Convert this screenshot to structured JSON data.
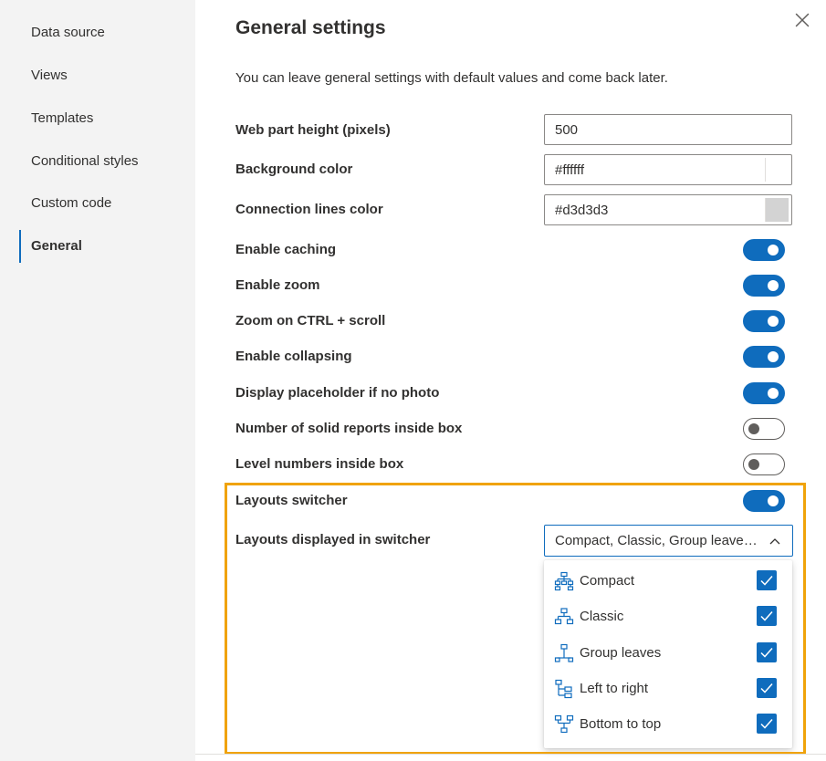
{
  "sidebar": {
    "items": [
      {
        "label": "Data source"
      },
      {
        "label": "Views"
      },
      {
        "label": "Templates"
      },
      {
        "label": "Conditional styles"
      },
      {
        "label": "Custom code"
      },
      {
        "label": "General"
      }
    ],
    "active": "General"
  },
  "panel": {
    "title": "General settings",
    "description": "You can leave general settings with default values and come back later."
  },
  "settings": {
    "web_part_height": {
      "label": "Web part height (pixels)",
      "value": "500"
    },
    "background_color": {
      "label": "Background color",
      "value": "#ffffff",
      "swatch": "#ffffff"
    },
    "connection_lines_color": {
      "label": "Connection lines color",
      "value": "#d3d3d3",
      "swatch": "#d3d3d3"
    },
    "toggles": [
      {
        "label": "Enable caching",
        "on": true
      },
      {
        "label": "Enable zoom",
        "on": true
      },
      {
        "label": "Zoom on CTRL + scroll",
        "on": true
      },
      {
        "label": "Enable collapsing",
        "on": true
      },
      {
        "label": "Display placeholder if no photo",
        "on": true
      },
      {
        "label": "Number of solid reports inside box",
        "on": false
      },
      {
        "label": "Level numbers inside box",
        "on": false
      },
      {
        "label": "Layouts switcher",
        "on": true
      }
    ],
    "layouts_displayed": {
      "label": "Layouts displayed in switcher",
      "value": "Compact, Classic, Group leaves, Left to right, Bottom to top",
      "options": [
        {
          "label": "Compact",
          "icon": "compact-layout-icon",
          "checked": true
        },
        {
          "label": "Classic",
          "icon": "classic-layout-icon",
          "checked": true
        },
        {
          "label": "Group leaves",
          "icon": "group-leaves-layout-icon",
          "checked": true
        },
        {
          "label": "Left to right",
          "icon": "left-to-right-layout-icon",
          "checked": true
        },
        {
          "label": "Bottom to top",
          "icon": "bottom-to-top-layout-icon",
          "checked": true
        }
      ]
    }
  },
  "colors": {
    "accent": "#0f6cbd",
    "highlight": "#f0a30a",
    "sidebar_bg": "#f3f3f3"
  }
}
